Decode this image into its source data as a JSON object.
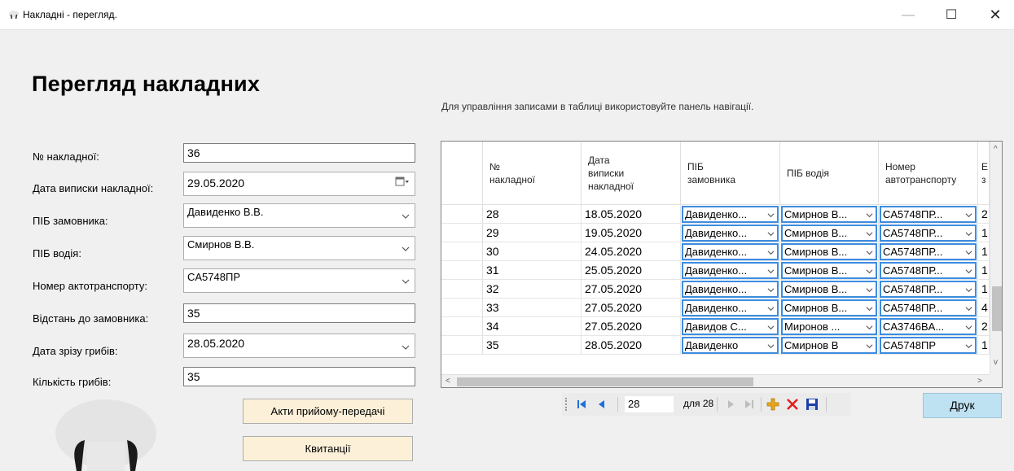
{
  "window": {
    "title": "Накладні - перегляд.",
    "controls": {
      "minimize": "—",
      "maximize": "☐",
      "close": "✕"
    }
  },
  "page_title": "Перегляд накладних",
  "hint": "Для управління записами в таблиці використовуйте панель навігації.",
  "form": {
    "fields": [
      {
        "label": "№ накладної:",
        "value": "36",
        "kind": "text"
      },
      {
        "label": "Дата виписки накладної:",
        "value": "29.05.2020",
        "kind": "date"
      },
      {
        "label": "ПІБ замовника:",
        "value": "Давиденко В.В.",
        "kind": "combo"
      },
      {
        "label": "ПІБ водія:",
        "value": "Смирнов В.В.",
        "kind": "combo"
      },
      {
        "label": "Номер актотранспорту:",
        "value": "CA5748ПР",
        "kind": "combo"
      },
      {
        "label": "Відстань до замовника:",
        "value": "35",
        "kind": "text"
      },
      {
        "label": "Дата зрізу грибів:",
        "value": "28.05.2020",
        "kind": "combo"
      },
      {
        "label": "Кількість грибів:",
        "value": "35",
        "kind": "text"
      }
    ],
    "buttons": {
      "acts": "Акти прийому-передачі",
      "receipts": "Квитанції"
    }
  },
  "grid": {
    "columns": [
      "№ накладної",
      "Дата виписки накладної",
      "ПІБ замовника",
      "ПІБ водія",
      "Номер автотранспорту",
      "Е з"
    ],
    "rows": [
      [
        "28",
        "18.05.2020",
        "Давиденко...",
        "Смирнов В...",
        "CA5748ПР...",
        "2"
      ],
      [
        "29",
        "19.05.2020",
        "Давиденко...",
        "Смирнов В...",
        "CA5748ПР...",
        "1"
      ],
      [
        "30",
        "24.05.2020",
        "Давиденко...",
        "Смирнов В...",
        "CA5748ПР...",
        "1"
      ],
      [
        "31",
        "25.05.2020",
        "Давиденко...",
        "Смирнов В...",
        "CA5748ПР...",
        "1"
      ],
      [
        "32",
        "27.05.2020",
        "Давиденко...",
        "Смирнов В...",
        "CA5748ПР...",
        "1"
      ],
      [
        "33",
        "27.05.2020",
        "Давиденко...",
        "Смирнов В...",
        "CA5748ПР...",
        "4"
      ],
      [
        "34",
        "27.05.2020",
        "Давидов С...",
        "Миронов ...",
        "CA3746BA...",
        "2"
      ],
      [
        "35",
        "28.05.2020",
        "Давиденко",
        "Смирнов В",
        "CA5748ПР",
        "1"
      ]
    ]
  },
  "navigator": {
    "position": "28",
    "count": "для 28"
  },
  "print_button": "Друк",
  "colors": {
    "button_warm": "#fdf0d8",
    "button_print": "#bfe2f3",
    "combo_border": "#3d8ce0",
    "nav_blue": "#1e6fd9",
    "add_icon": "#e8a51a",
    "delete_icon": "#e02020",
    "save_icon": "#1a3fa8"
  },
  "icons": [
    "app-icon",
    "calendar-icon",
    "chevron-down-icon",
    "move-first-icon",
    "move-prev-icon",
    "move-next-icon",
    "move-last-icon",
    "add-icon",
    "delete-icon",
    "save-icon",
    "mushroom-logo"
  ]
}
